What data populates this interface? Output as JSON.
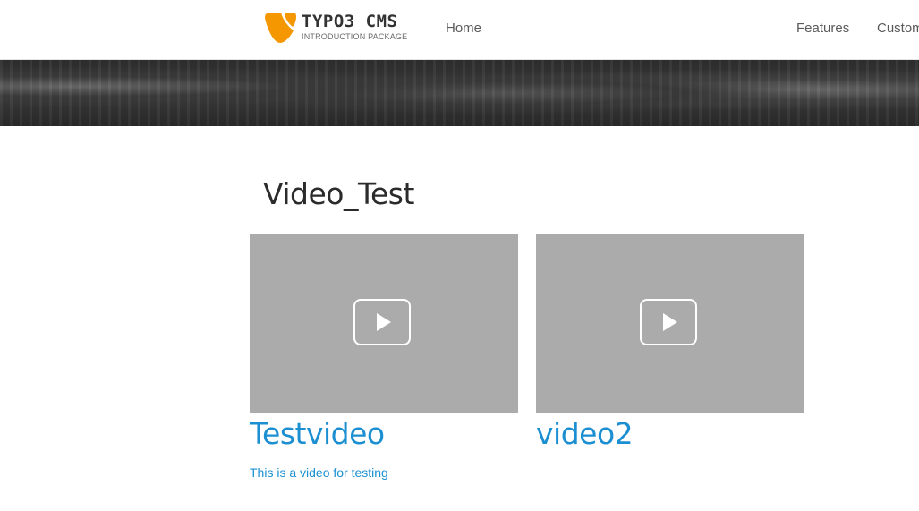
{
  "header": {
    "logo": {
      "title": "TYPO3 CMS",
      "subtitle": "INTRODUCTION PACKAGE",
      "brand_color": "#f49700"
    },
    "nav": [
      {
        "label": "Home"
      },
      {
        "label": "Features"
      },
      {
        "label": "Custom"
      }
    ]
  },
  "main": {
    "title": "Video_Test",
    "videos": [
      {
        "title": "Testvideo",
        "description": "This is a video for testing",
        "icon": "play-icon"
      },
      {
        "title": "video2",
        "description": "",
        "icon": "play-icon"
      }
    ]
  },
  "colors": {
    "link": "#1b8fd1",
    "thumbnail": "#ababab",
    "text": "#2b2b2b"
  }
}
